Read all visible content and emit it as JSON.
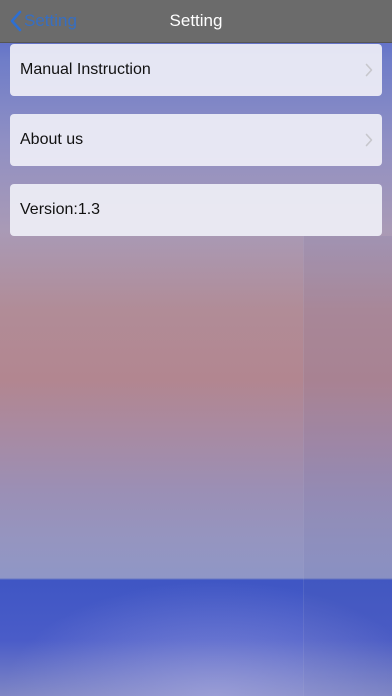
{
  "navbar": {
    "back_label": "Setting",
    "title": "Setting"
  },
  "menu": {
    "items": [
      {
        "label": "Manual Instruction",
        "icon": "chevron-right-icon"
      },
      {
        "label": "About us",
        "icon": "chevron-right-icon"
      }
    ],
    "version_text": "Version:1.3"
  },
  "colors": {
    "navbar_bg": "#6b6b6b",
    "back_accent": "#2d6fd2",
    "cell_bg": "#eeeef6"
  }
}
